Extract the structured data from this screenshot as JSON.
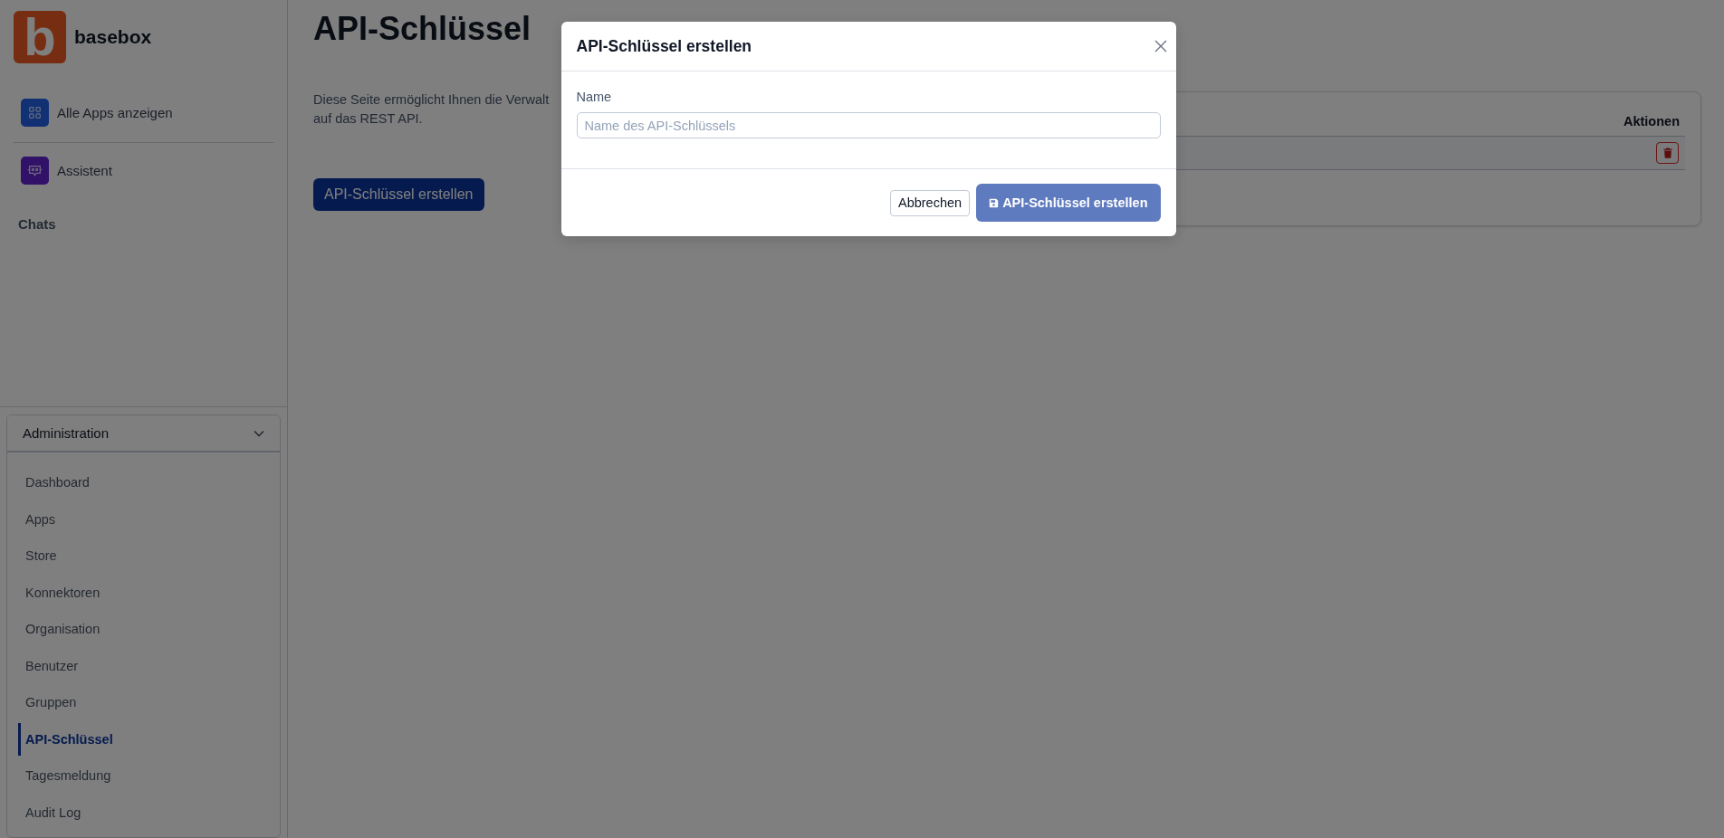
{
  "sidebar": {
    "logo_letter": "b",
    "brand_name": "basebox",
    "links": [
      {
        "label": "Alle Apps anzeigen",
        "kind": "apps"
      },
      {
        "label": "Assistent",
        "kind": "assistant"
      }
    ],
    "section_title": "Chats",
    "admin": {
      "title": "Administration",
      "expanded": true,
      "items": [
        {
          "label": "Dashboard",
          "selected": false
        },
        {
          "label": "Apps",
          "selected": false
        },
        {
          "label": "Store",
          "selected": false
        },
        {
          "label": "Konnektoren",
          "selected": false
        },
        {
          "label": "Organisation",
          "selected": false
        },
        {
          "label": "Benutzer",
          "selected": false
        },
        {
          "label": "Gruppen",
          "selected": false
        },
        {
          "label": "API-Schlüssel",
          "selected": true
        },
        {
          "label": "Tagesmeldung",
          "selected": false
        },
        {
          "label": "Audit Log",
          "selected": false
        }
      ]
    }
  },
  "page": {
    "title": "API-Schlüssel",
    "description_lines": [
      "Diese Seite ermöglicht Ihnen die Verwalt",
      "auf das REST API."
    ],
    "create_button": "API-Schlüssel erstellen",
    "table": {
      "columns": [
        "Aktionen"
      ],
      "rows": [
        {
          "actions": [
            {
              "kind": "delete"
            }
          ]
        }
      ]
    }
  },
  "modal": {
    "title": "API-Schlüssel erstellen",
    "fields": [
      {
        "label": "Name",
        "placeholder": "Name des API-Schlüssels"
      }
    ],
    "buttons": [
      {
        "label": "Abbrechen",
        "kind": "secondary",
        "disabled": false
      },
      {
        "label": "API-Schlüssel erstellen",
        "kind": "primary",
        "disabled": true
      }
    ]
  }
}
